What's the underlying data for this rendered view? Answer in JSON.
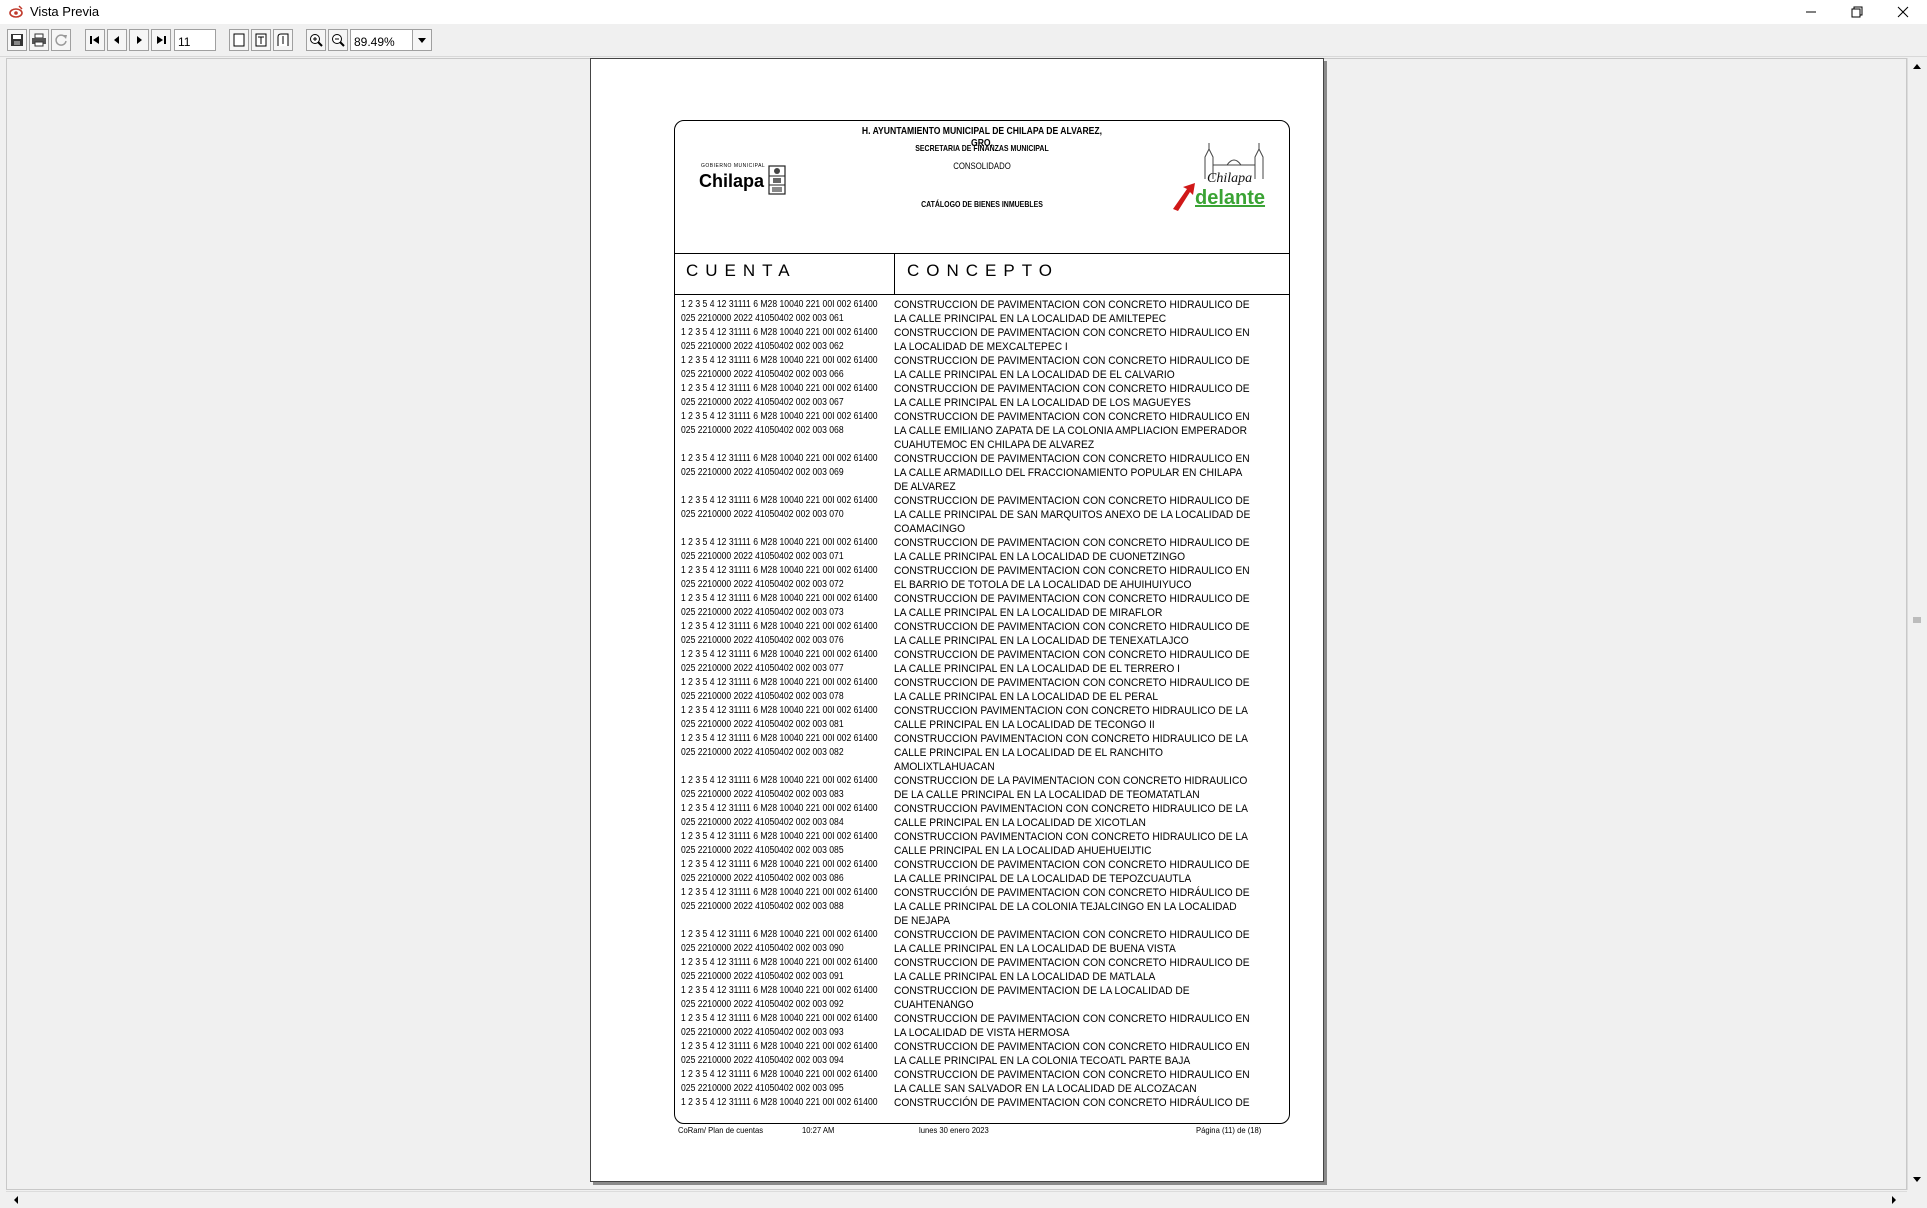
{
  "window": {
    "title": "Vista Previa",
    "app_icon": "document-eye-icon"
  },
  "toolbar": {
    "save_icon": "floppy-disk-icon",
    "print_icon": "printer-icon",
    "refresh_icon": "refresh-icon",
    "first_icon": "first-page-icon",
    "prev_icon": "previous-page-icon",
    "next_icon": "next-page-icon",
    "last_icon": "last-page-icon",
    "page_number": "11",
    "single_page_icon": "single-page-icon",
    "page_width_icon": "page-width-icon",
    "page_height_icon": "page-height-icon",
    "zoom_in_icon": "zoom-in-icon",
    "zoom_out_icon": "zoom-out-icon",
    "zoom_level": "89.49%"
  },
  "report": {
    "header": {
      "line1": "H. AYUNTAMIENTO MUNICIPAL DE CHILAPA DE ALVAREZ, GRO.",
      "line2": "SECRETARIA DE FINANZAS MUNICIPAL",
      "line3": "CONSOLIDADO",
      "line4": "CATÁLOGO DE BIENES INMUEBLES",
      "left_logo_small": "GOBIERNO MUNICIPAL",
      "left_logo_text": "Chilapa",
      "right_logo_text1": "Chilapa",
      "right_logo_text2": "delante"
    },
    "columns": {
      "cuenta": "CUENTA",
      "concepto": "CONCEPTO"
    },
    "rows": [
      {
        "a1": "1 2 3 5 4 12 31111 6 M28 10040 221 00I 002 61400",
        "a2": "025 2210000 2022 41050402 002 003 061",
        "desc": "CONSTRUCCION DE PAVIMENTACION CON CONCRETO HIDRAULICO DE LA  CALLE PRINCIPAL EN LA LOCALIDAD DE AMILTEPEC"
      },
      {
        "a1": "1 2 3 5 4 12 31111 6 M28 10040 221 00I 002 61400",
        "a2": "025 2210000 2022 41050402 002 003 062",
        "desc": "CONSTRUCCION DE PAVIMENTACION CON CONCRETO HIDRAULICO EN LA LOCALIDAD DE MEXCALTEPEC I"
      },
      {
        "a1": "1 2 3 5 4 12 31111 6 M28 10040 221 00I 002 61400",
        "a2": "025 2210000 2022 41050402 002 003 066",
        "desc": "CONSTRUCCION DE PAVIMENTACION CON CONCRETO HIDRAULICO DE LA CALLE PRINCIPAL EN LA LOCALIDAD DE EL CALVARIO"
      },
      {
        "a1": "1 2 3 5 4 12 31111 6 M28 10040 221 00I 002 61400",
        "a2": "025 2210000 2022 41050402 002 003 067",
        "desc": "CONSTRUCCION DE PAVIMENTACION CON CONCRETO HIDRAULICO DE LA CALLE PRINCIPAL EN LA LOCALIDAD DE LOS MAGUEYES"
      },
      {
        "a1": "1 2 3 5 4 12 31111 6 M28 10040 221 00I 002 61400",
        "a2": "025 2210000 2022 41050402 002 003 068",
        "desc": "CONSTRUCCION DE PAVIMENTACION CON CONCRETO HIDRAULICO EN LA CALLE  EMILIANO ZAPATA DE LA COLONIA AMPLIACION EMPERADOR CUAHUTEMOC EN CHILAPA DE ALVAREZ"
      },
      {
        "a1": "1 2 3 5 4 12 31111 6 M28 10040 221 00I 002 61400",
        "a2": "025 2210000 2022 41050402 002 003 069",
        "desc": "CONSTRUCCION DE PAVIMENTACION CON CONCRETO HIDRAULICO EN LA CALLE ARMADILLO DEL FRACCIONAMIENTO POPULAR EN CHILAPA DE ALVAREZ"
      },
      {
        "a1": "1 2 3 5 4 12 31111 6 M28 10040 221 00I 002 61400",
        "a2": "025 2210000 2022 41050402 002 003 070",
        "desc": "CONSTRUCCION DE PAVIMENTACION CON CONCRETO HIDRAULICO DE LA CALLE PRINCIPAL DE SAN MARQUITOS ANEXO DE LA LOCALIDAD DE COAMACINGO"
      },
      {
        "a1": "1 2 3 5 4 12 31111 6 M28 10040 221 00I 002 61400",
        "a2": "025 2210000 2022 41050402 002 003 071",
        "desc": "CONSTRUCCION DE PAVIMENTACION CON CONCRETO HIDRAULICO DE LA CALLE PRINCIPAL EN LA LOCALIDAD DE CUONETZINGO"
      },
      {
        "a1": "1 2 3 5 4 12 31111 6 M28 10040 221 00I 002 61400",
        "a2": "025 2210000 2022 41050402 002 003 072",
        "desc": "CONSTRUCCION DE PAVIMENTACION CON CONCRETO HIDRAULICO EN EL BARRIO DE TOTOLA DE LA LOCALIDAD DE AHUIHUIYUCO"
      },
      {
        "a1": "1 2 3 5 4 12 31111 6 M28 10040 221 00I 002 61400",
        "a2": "025 2210000 2022 41050402 002 003 073",
        "desc": "CONSTRUCCION DE PAVIMENTACION CON CONCRETO HIDRAULICO DE LA CALLE PRINCIPAL EN LA LOCALIDAD DE MIRAFLOR"
      },
      {
        "a1": "1 2 3 5 4 12 31111 6 M28 10040 221 00I 002 61400",
        "a2": "025 2210000 2022 41050402 002 003 076",
        "desc": "CONSTRUCCION DE PAVIMENTACION CON CONCRETO HIDRAULICO DE LA CALLE PRINCIPAL EN LA LOCALIDAD DE TENEXATLAJCO"
      },
      {
        "a1": "1 2 3 5 4 12 31111 6 M28 10040 221 00I 002 61400",
        "a2": "025 2210000 2022 41050402 002 003 077",
        "desc": "CONSTRUCCION DE PAVIMENTACION CON CONCRETO HIDRAULICO DE LA CALLE PRINCIPAL EN LA LOCALIDAD DE EL TERRERO I"
      },
      {
        "a1": "1 2 3 5 4 12 31111 6 M28 10040 221 00I 002 61400",
        "a2": "025 2210000 2022 41050402 002 003 078",
        "desc": "CONSTRUCCION DE PAVIMENTACION CON CONCRETO HIDRAULICO DE LA CALLE PRINCIPAL EN LA LOCALIDAD DE EL PERAL"
      },
      {
        "a1": "1 2 3 5 4 12 31111 6 M28 10040 221 00I 002 61400",
        "a2": "025 2210000 2022 41050402 002 003 081",
        "desc": "CONSTRUCCION PAVIMENTACION CON CONCRETO HIDRAULICO DE LA CALLE PRINCIPAL EN LA LOCALIDAD DE TECONGO II"
      },
      {
        "a1": "1 2 3 5 4 12 31111 6 M28 10040 221 00I 002 61400",
        "a2": "025 2210000 2022 41050402 002 003 082",
        "desc": "CONSTRUCCION PAVIMENTACION CON CONCRETO HIDRAULICO DE LA CALLE PRINCIPAL EN LA LOCALIDAD DE EL RANCHITO AMOLIXTLAHUACAN"
      },
      {
        "a1": "1 2 3 5 4 12 31111 6 M28 10040 221 00I 002 61400",
        "a2": "025 2210000 2022 41050402 002 003 083",
        "desc": "CONSTRUCCION DE LA PAVIMENTACION CON CONCRETO HIDRAULICO DE LA CALLE PRINCIPAL EN LA LOCALIDAD DE TEOMATATLAN"
      },
      {
        "a1": "1 2 3 5 4 12 31111 6 M28 10040 221 00I 002 61400",
        "a2": "025 2210000 2022 41050402 002 003 084",
        "desc": "CONSTRUCCION PAVIMENTACION CON CONCRETO HIDRAULICO DE LA CALLE PRINCIPAL EN LA LOCALIDAD DE XICOTLAN"
      },
      {
        "a1": "1 2 3 5 4 12 31111 6 M28 10040 221 00I 002 61400",
        "a2": "025 2210000 2022 41050402 002 003 085",
        "desc": "CONSTRUCCION PAVIMENTACION CON CONCRETO HIDRAULICO DE LA CALLE PRINCIPAL EN LA LOCALIDAD AHUEHUEIJTIC"
      },
      {
        "a1": "1 2 3 5 4 12 31111 6 M28 10040 221 00I 002 61400",
        "a2": "025 2210000 2022 41050402 002 003 086",
        "desc": "CONSTRUCCION DE PAVIMENTACION CON CONCRETO HIDRAULICO DE LA CALLE PRINCIPAL DE LA LOCALIDAD DE TEPOZCUAUTLA"
      },
      {
        "a1": "1 2 3 5 4 12 31111 6 M28 10040 221 00I 002 61400",
        "a2": "025 2210000 2022 41050402 002 003 088",
        "desc": "CONSTRUCCIÓN DE PAVIMENTACION CON CONCRETO HIDRÁULICO DE LA CALLE PRINCIPAL DE LA COLONIA TEJALCINGO EN LA LOCALIDAD DE NEJAPA"
      },
      {
        "a1": "1 2 3 5 4 12 31111 6 M28 10040 221 00I 002 61400",
        "a2": "025 2210000 2022 41050402 002 003 090",
        "desc": "CONSTRUCCION DE PAVIMENTACION CON CONCRETO HIDRAULICO DE LA CALLE PRINCIPAL EN LA LOCALIDAD DE BUENA VISTA"
      },
      {
        "a1": "1 2 3 5 4 12 31111 6 M28 10040 221 00I 002 61400",
        "a2": "025 2210000 2022 41050402 002 003 091",
        "desc": "CONSTRUCCION DE PAVIMENTACION CON CONCRETO HIDRAULICO DE LA CALLE PRINCIPAL EN LA LOCALIDAD DE MATLALA"
      },
      {
        "a1": "1 2 3 5 4 12 31111 6 M28 10040 221 00I 002 61400",
        "a2": "025 2210000 2022 41050402 002 003 092",
        "desc": "CONSTRUCCION DE PAVIMENTACION DE LA LOCALIDAD DE CUAHTENANGO"
      },
      {
        "a1": "1 2 3 5 4 12 31111 6 M28 10040 221 00I 002 61400",
        "a2": "025 2210000 2022 41050402 002 003 093",
        "desc": "CONSTRUCCION DE PAVIMENTACION CON CONCRETO HIDRAULICO EN LA LOCALIDAD DE VISTA HERMOSA"
      },
      {
        "a1": "1 2 3 5 4 12 31111 6 M28 10040 221 00I 002 61400",
        "a2": "025 2210000 2022 41050402 002 003 094",
        "desc": "CONSTRUCCION DE PAVIMENTACION CON CONCRETO HIDRAULICO EN LA CALLE PRINCIPAL EN LA COLONIA TECOATL PARTE BAJA"
      },
      {
        "a1": "1 2 3 5 4 12 31111 6 M28 10040 221 00I 002 61400",
        "a2": "025 2210000 2022 41050402 002 003 095",
        "desc": "CONSTRUCCION DE PAVIMENTACION CON CONCRETO HIDRAULICO EN LA CALLE SAN SALVADOR EN LA LOCALIDAD DE ALCOZACAN"
      },
      {
        "a1": "1 2 3 5 4 12 31111 6 M28 10040 221 00I 002 61400",
        "a2": "",
        "desc": "CONSTRUCCIÓN DE PAVIMENTACION CON CONCRETO  HIDRÁULICO DE"
      }
    ],
    "footer": {
      "system": "CoRam/ Plan de cuentas",
      "time": "10:27 AM",
      "date": "lunes 30 enero 2023",
      "page": "Página (11) de (18)"
    }
  }
}
